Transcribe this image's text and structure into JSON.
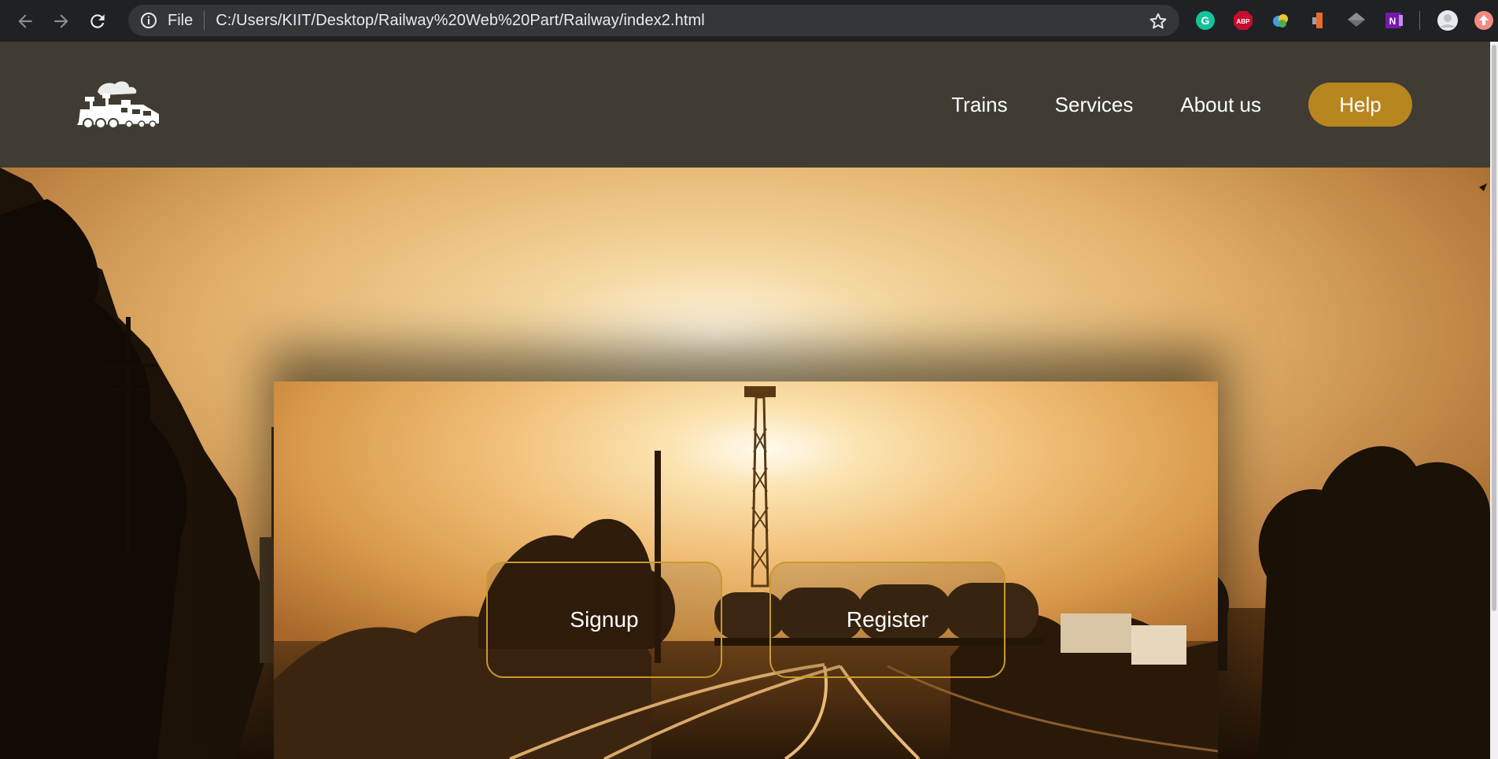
{
  "browser": {
    "scheme": "File",
    "url": "C:/Users/KIIT/Desktop/Railway%20Web%20Part/Railway/index2.html",
    "extensions": [
      "grammarly-icon",
      "adblock-plus-icon",
      "color-picker-icon",
      "extension-icon",
      "layers-icon",
      "onenote-icon",
      "profile-avatar",
      "update-icon"
    ]
  },
  "header": {
    "nav": [
      "Trains",
      "Services",
      "About us"
    ],
    "help_label": "Help"
  },
  "hero": {
    "signup_label": "Signup",
    "register_label": "Register"
  },
  "colors": {
    "header_bg": "#403c33",
    "accent": "#b8861e",
    "cta_border": "#c79a2d"
  }
}
